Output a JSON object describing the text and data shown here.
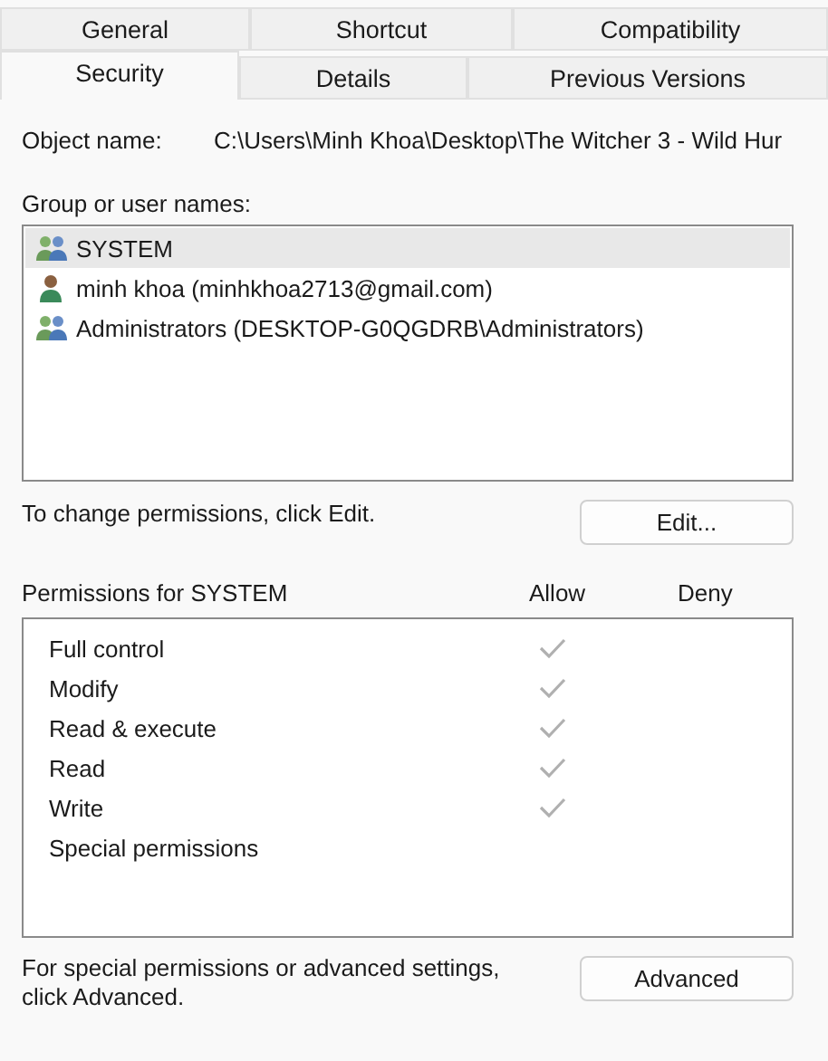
{
  "tabs": [
    [
      {
        "label": "General",
        "selected": false
      },
      {
        "label": "Shortcut",
        "selected": false
      },
      {
        "label": "Compatibility",
        "selected": false
      }
    ],
    [
      {
        "label": "Security",
        "selected": true
      },
      {
        "label": "Details",
        "selected": false
      },
      {
        "label": "Previous Versions",
        "selected": false
      }
    ]
  ],
  "object_name": {
    "label": "Object name:",
    "value": "C:\\Users\\Minh Khoa\\Desktop\\The Witcher 3 - Wild Hur"
  },
  "group_list": {
    "label": "Group or user names:",
    "items": [
      {
        "name": "SYSTEM",
        "kind": "group",
        "selected": true
      },
      {
        "name": "minh khoa (minhkhoa2713@gmail.com)",
        "kind": "user",
        "selected": false
      },
      {
        "name": "Administrators (DESKTOP-G0QGDRB\\Administrators)",
        "kind": "group",
        "selected": false
      }
    ]
  },
  "edit_hint": "To change permissions, click Edit.",
  "edit_button": "Edit...",
  "permissions": {
    "title": "Permissions for SYSTEM",
    "allow_header": "Allow",
    "deny_header": "Deny",
    "rows": [
      {
        "name": "Full control",
        "allow": true,
        "deny": false
      },
      {
        "name": "Modify",
        "allow": true,
        "deny": false
      },
      {
        "name": "Read & execute",
        "allow": true,
        "deny": false
      },
      {
        "name": "Read",
        "allow": true,
        "deny": false
      },
      {
        "name": "Write",
        "allow": true,
        "deny": false
      },
      {
        "name": "Special permissions",
        "allow": false,
        "deny": false
      }
    ]
  },
  "advanced_hint": "For special permissions or advanced settings, click Advanced.",
  "advanced_button": "Advanced"
}
